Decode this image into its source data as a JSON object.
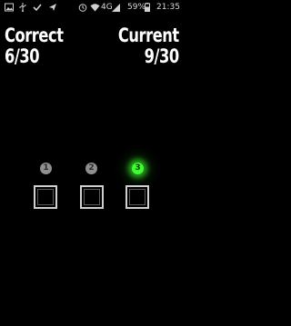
{
  "status_bar": {
    "icons_left": [
      "image-icon",
      "usb-icon",
      "check-icon",
      "send-icon"
    ],
    "icons_right": [
      "alarm-icon",
      "wifi-icon",
      "signal-icon",
      "battery-icon"
    ],
    "network": "4G",
    "battery": "59%",
    "time": "21:35"
  },
  "score": {
    "correct_label": "Correct",
    "correct_value": "6/30",
    "current_label": "Current",
    "current_value": "9/30"
  },
  "steps": [
    {
      "label": "1",
      "active": false
    },
    {
      "label": "2",
      "active": false
    },
    {
      "label": "3",
      "active": true
    }
  ],
  "colors": {
    "background": "#000000",
    "active_glow": "#3cff2f",
    "inactive_indicator": "#8f8f8f",
    "box_border": "#cfcfcf"
  }
}
